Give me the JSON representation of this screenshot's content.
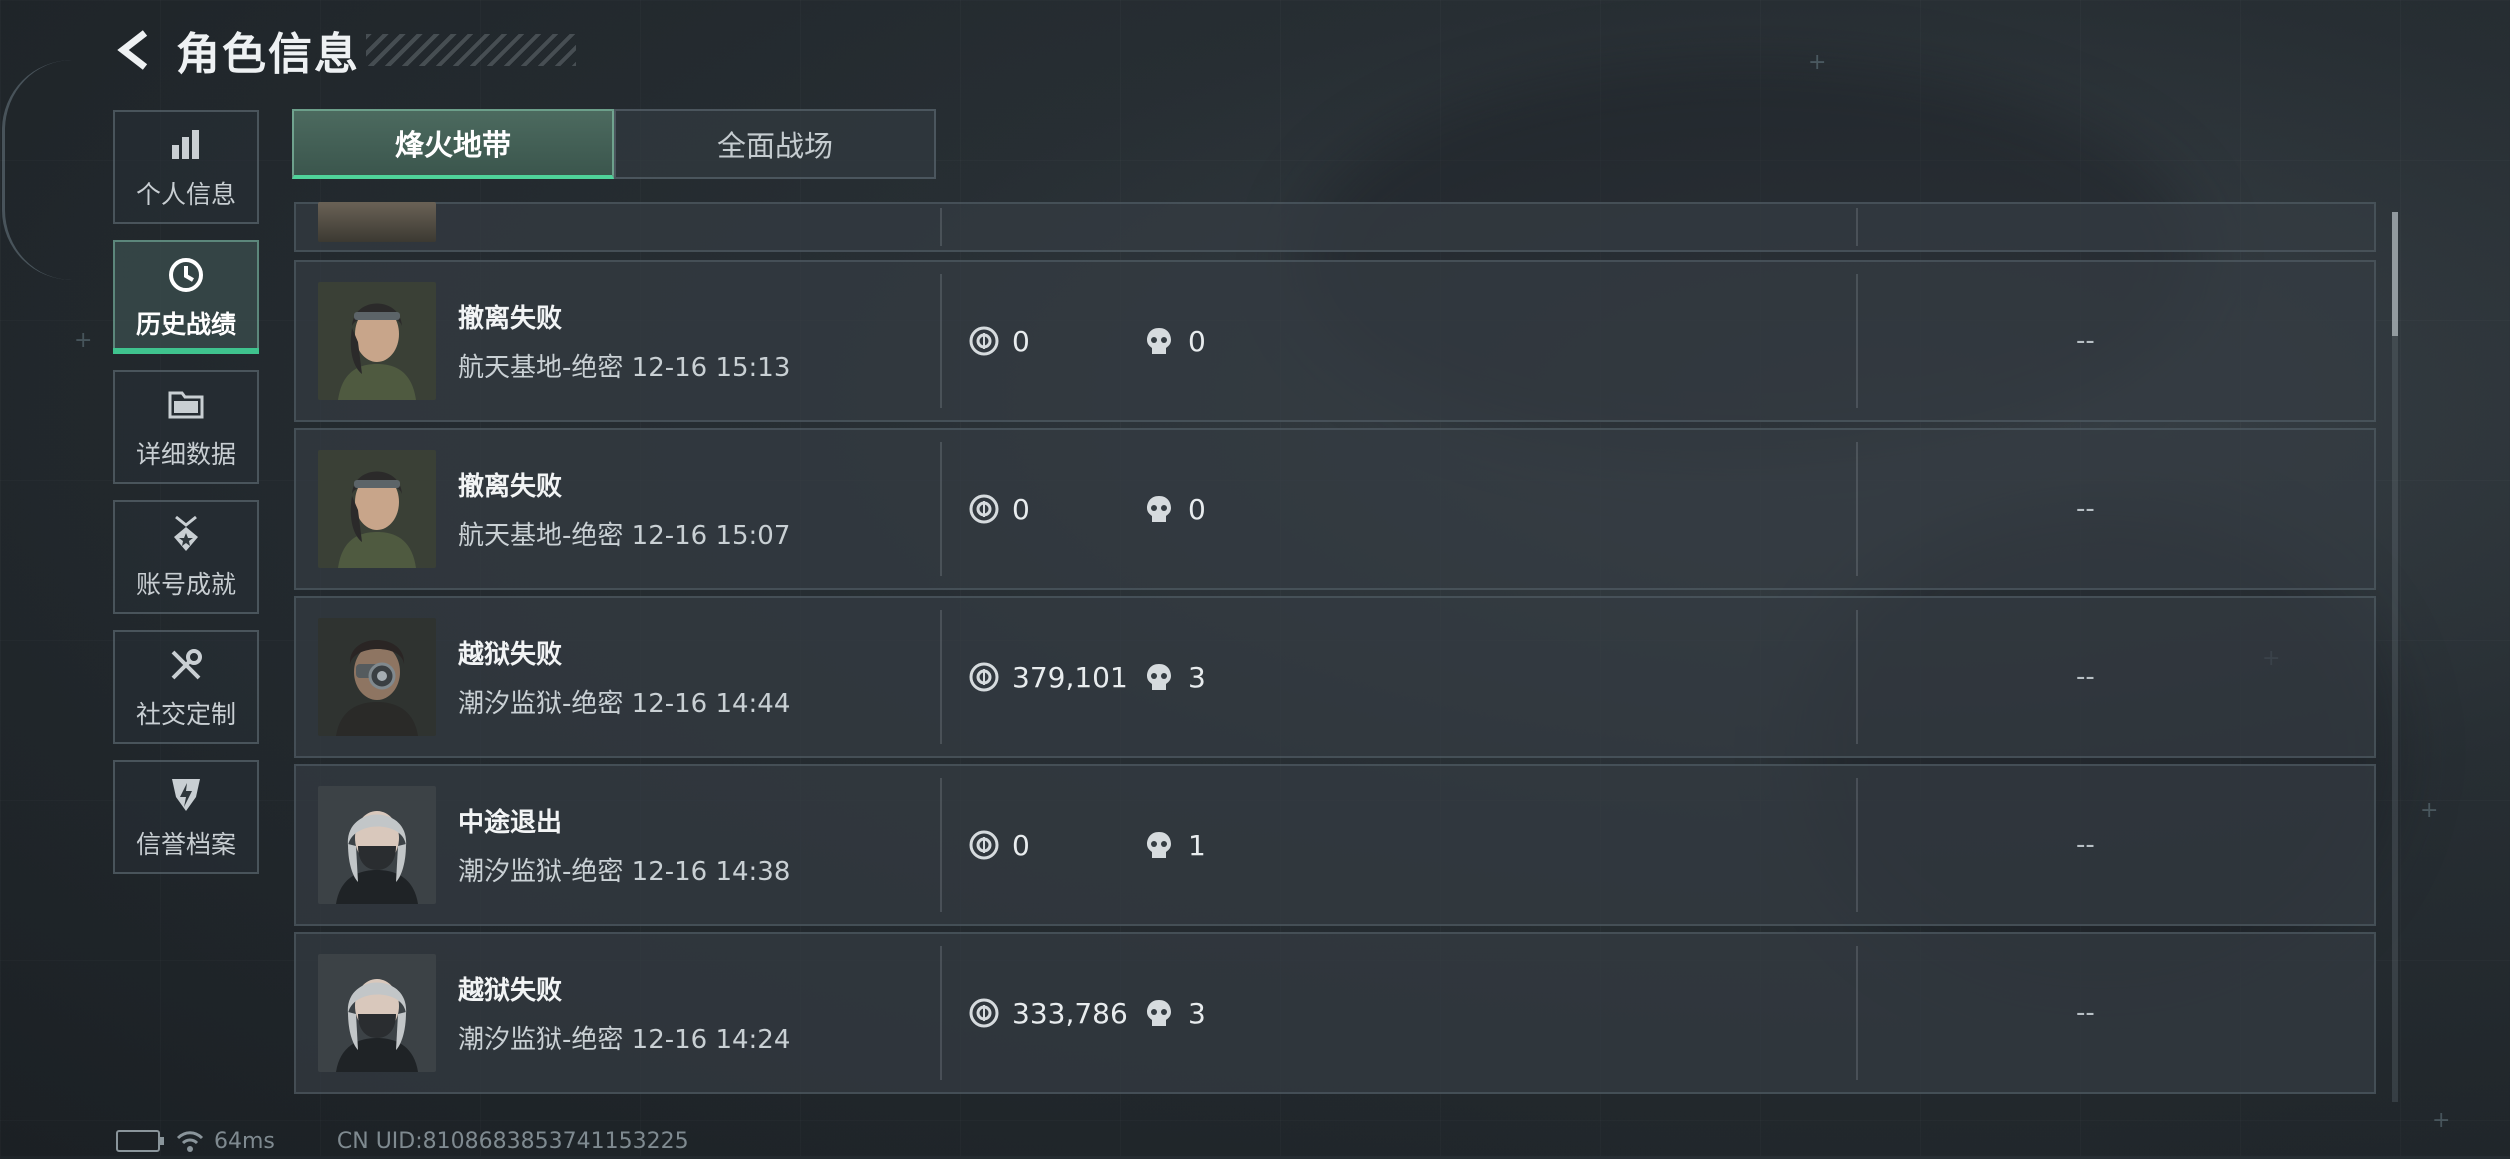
{
  "header": {
    "title": "角色信息"
  },
  "sidenav": [
    {
      "label": "个人信息",
      "icon": "bar-chart-icon"
    },
    {
      "label": "历史战绩",
      "icon": "clock-icon",
      "active": true
    },
    {
      "label": "详细数据",
      "icon": "folder-icon"
    },
    {
      "label": "账号成就",
      "icon": "medal-icon"
    },
    {
      "label": "社交定制",
      "icon": "wrench-icon"
    },
    {
      "label": "信誉档案",
      "icon": "shield-icon"
    }
  ],
  "tabs": [
    {
      "label": "烽火地带",
      "active": true
    },
    {
      "label": "全面战场"
    }
  ],
  "matches": [
    {
      "result": "撤离失败",
      "detail": "航天基地-绝密 12-16 15:13",
      "value": "0",
      "kills": "0",
      "extra": "--",
      "avatar": "female-operator-goggles"
    },
    {
      "result": "撤离失败",
      "detail": "航天基地-绝密 12-16 15:07",
      "value": "0",
      "kills": "0",
      "extra": "--",
      "avatar": "female-operator-goggles"
    },
    {
      "result": "越狱失败",
      "detail": "潮汐监狱-绝密 12-16 14:44",
      "value": "379,101",
      "kills": "3",
      "extra": "--",
      "avatar": "operator-visor"
    },
    {
      "result": "中途退出",
      "detail": "潮汐监狱-绝密 12-16 14:38",
      "value": "0",
      "kills": "1",
      "extra": "--",
      "avatar": "female-operator-masked"
    },
    {
      "result": "越狱失败",
      "detail": "潮汐监狱-绝密 12-16 14:24",
      "value": "333,786",
      "kills": "3",
      "extra": "--",
      "avatar": "female-operator-masked"
    }
  ],
  "status": {
    "ping": "64ms",
    "uid": "CN UID:8108683853741153225"
  }
}
